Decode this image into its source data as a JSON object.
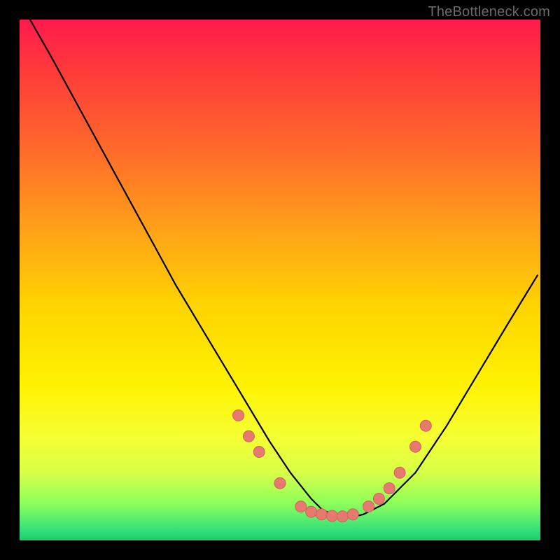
{
  "watermark": "TheBottleneck.com",
  "colors": {
    "dot_fill": "#e77a70",
    "dot_stroke": "#d46058",
    "curve": "#000000"
  },
  "chart_data": {
    "type": "line",
    "title": "",
    "xlabel": "",
    "ylabel": "",
    "xlim": [
      0,
      100
    ],
    "ylim": [
      0,
      100
    ],
    "series": [
      {
        "name": "curve",
        "x": [
          2,
          6,
          12,
          18,
          24,
          30,
          36,
          42,
          48,
          52,
          56,
          58,
          60,
          62,
          64,
          66,
          70,
          76,
          82,
          88,
          94,
          99.5
        ],
        "y": [
          100,
          93,
          82,
          71,
          60,
          49,
          39,
          29,
          19,
          13,
          8,
          6,
          5,
          4.5,
          4.5,
          5,
          7,
          13,
          22,
          32,
          42,
          51
        ]
      }
    ],
    "points": [
      {
        "x": 42,
        "y": 24
      },
      {
        "x": 44,
        "y": 20
      },
      {
        "x": 46,
        "y": 17
      },
      {
        "x": 50,
        "y": 11
      },
      {
        "x": 54,
        "y": 6.5
      },
      {
        "x": 56,
        "y": 5.5
      },
      {
        "x": 58,
        "y": 5
      },
      {
        "x": 60,
        "y": 4.7
      },
      {
        "x": 62,
        "y": 4.6
      },
      {
        "x": 64,
        "y": 5
      },
      {
        "x": 67,
        "y": 6.5
      },
      {
        "x": 69,
        "y": 8
      },
      {
        "x": 71,
        "y": 10
      },
      {
        "x": 73,
        "y": 13
      },
      {
        "x": 76,
        "y": 18
      },
      {
        "x": 78,
        "y": 22
      }
    ]
  }
}
